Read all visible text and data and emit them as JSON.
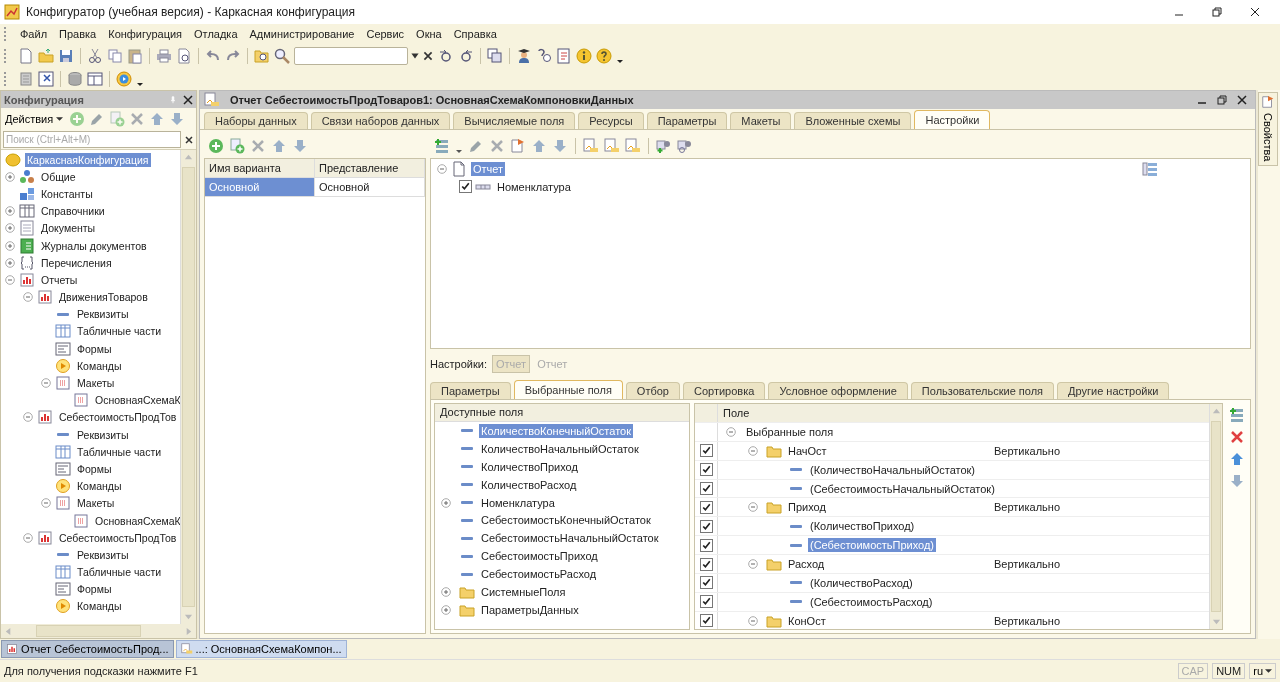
{
  "window": {
    "title": "Конфигуратор (учебная версия) - Каркасная конфигурация"
  },
  "menu": [
    "Файл",
    "Правка",
    "Конфигурация",
    "Отладка",
    "Администрирование",
    "Сервис",
    "Окна",
    "Справка"
  ],
  "left_panel": {
    "title": "Конфигурация",
    "actions_label": "Действия",
    "search": {
      "placeholder": "Поиск (Ctrl+Alt+M)"
    },
    "tree": {
      "label": "КаркаснаяКонфигурация",
      "kind": "root",
      "selected": true,
      "children": [
        {
          "label": "Общие",
          "kind": "common",
          "expanded": false,
          "selected": false
        },
        {
          "label": "Константы",
          "kind": "constants",
          "selected": false
        },
        {
          "label": "Справочники",
          "kind": "catalog",
          "expanded": false,
          "selected": false
        },
        {
          "label": "Документы",
          "kind": "document",
          "expanded": false,
          "selected": false
        },
        {
          "label": "Журналы документов",
          "kind": "journal",
          "expanded": false,
          "selected": false
        },
        {
          "label": "Перечисления",
          "kind": "enum",
          "expanded": false,
          "selected": false
        },
        {
          "label": "Отчеты",
          "kind": "report",
          "expanded": true,
          "selected": false,
          "children": [
            {
              "label": "ДвиженияТоваров",
              "kind": "report",
              "expanded": true,
              "selected": false,
              "children": [
                {
                  "label": "Реквизиты",
                  "kind": "attribute",
                  "selected": false
                },
                {
                  "label": "Табличные части",
                  "kind": "tabular",
                  "selected": false
                },
                {
                  "label": "Формы",
                  "kind": "form",
                  "selected": false
                },
                {
                  "label": "Команды",
                  "kind": "command",
                  "selected": false
                },
                {
                  "label": "Макеты",
                  "kind": "template",
                  "expanded": true,
                  "selected": false,
                  "children": [
                    {
                      "label": "ОсновнаяСхемаК",
                      "kind": "layout",
                      "selected": false
                    }
                  ]
                }
              ]
            },
            {
              "label": "СебестоимостьПродТов",
              "kind": "report",
              "expanded": true,
              "selected": false,
              "children": [
                {
                  "label": "Реквизиты",
                  "kind": "attribute",
                  "selected": false
                },
                {
                  "label": "Табличные части",
                  "kind": "tabular",
                  "selected": false
                },
                {
                  "label": "Формы",
                  "kind": "form",
                  "selected": false
                },
                {
                  "label": "Команды",
                  "kind": "command",
                  "selected": false
                },
                {
                  "label": "Макеты",
                  "kind": "template",
                  "expanded": true,
                  "selected": false,
                  "children": [
                    {
                      "label": "ОсновнаяСхемаК",
                      "kind": "layout",
                      "selected": false
                    }
                  ]
                }
              ]
            },
            {
              "label": "СебестоимостьПродТов",
              "kind": "report",
              "expanded": true,
              "selected": false,
              "children": [
                {
                  "label": "Реквизиты",
                  "kind": "attribute",
                  "selected": false
                },
                {
                  "label": "Табличные части",
                  "kind": "tabular",
                  "selected": false
                },
                {
                  "label": "Формы",
                  "kind": "form",
                  "selected": false
                },
                {
                  "label": "Команды",
                  "kind": "command",
                  "selected": false
                }
              ]
            }
          ]
        }
      ]
    }
  },
  "document": {
    "title": "Отчет СебестоимостьПродТоваров1: ОсновнаяСхемаКомпоновкиДанных",
    "tabs": [
      {
        "label": "Наборы данных",
        "selected": false
      },
      {
        "label": "Связи наборов данных",
        "selected": false
      },
      {
        "label": "Вычисляемые поля",
        "selected": false
      },
      {
        "label": "Ресурсы",
        "selected": false
      },
      {
        "label": "Параметры",
        "selected": false
      },
      {
        "label": "Макеты",
        "selected": false
      },
      {
        "label": "Вложенные схемы",
        "selected": false
      },
      {
        "label": "Настройки",
        "selected": true
      }
    ],
    "variants": {
      "columns": [
        "Имя варианта",
        "Представление"
      ],
      "rows": [
        {
          "cells": [
            "Основной",
            "Основной"
          ],
          "selected": true
        }
      ]
    },
    "structure": {
      "label": "Отчет",
      "expanded": true,
      "selected": true,
      "children": [
        {
          "label": "Номенклатура",
          "checked": true,
          "selected": false
        }
      ]
    },
    "settings_label": "Настройки:",
    "settings_buttons": [
      {
        "label": "Отчет",
        "pressed": true
      },
      {
        "label": "Отчет",
        "pressed": false
      }
    ],
    "subtabs": [
      {
        "label": "Параметры",
        "selected": false
      },
      {
        "label": "Выбранные поля",
        "selected": true
      },
      {
        "label": "Отбор",
        "selected": false
      },
      {
        "label": "Сортировка",
        "selected": false
      },
      {
        "label": "Условное оформление",
        "selected": false
      },
      {
        "label": "Пользовательские поля",
        "selected": false
      },
      {
        "label": "Другие настройки",
        "selected": false
      }
    ],
    "available_fields": {
      "title": "Доступные поля",
      "items": [
        {
          "label": "КоличествоКонечныйОстаток",
          "kind": "field",
          "selected": true
        },
        {
          "label": "КоличествоНачальныйОстаток",
          "kind": "field",
          "selected": false
        },
        {
          "label": "КоличествоПриход",
          "kind": "field",
          "selected": false
        },
        {
          "label": "КоличествоРасход",
          "kind": "field",
          "selected": false
        },
        {
          "label": "Номенклатура",
          "kind": "field",
          "expanded": false,
          "selected": false
        },
        {
          "label": "СебестоимостьКонечныйОстаток",
          "kind": "field",
          "selected": false
        },
        {
          "label": "СебестоимостьНачальныйОстаток",
          "kind": "field",
          "selected": false
        },
        {
          "label": "СебестоимостьПриход",
          "kind": "field",
          "selected": false
        },
        {
          "label": "СебестоимостьРасход",
          "kind": "field",
          "selected": false
        },
        {
          "label": "СистемныеПоля",
          "kind": "folder",
          "expanded": false,
          "selected": false
        },
        {
          "label": "ПараметрыДанных",
          "kind": "folder",
          "expanded": false,
          "selected": false
        }
      ]
    },
    "selected_fields": {
      "column": "Поле",
      "root": {
        "label": "Выбранные поля",
        "expanded": true,
        "children": [
          {
            "label": "НачОст",
            "kind": "folder",
            "checked": true,
            "expanded": true,
            "selected": false,
            "placement": "Вертикально",
            "children": [
              {
                "label": "(КоличествоНачальныйОстаток)",
                "kind": "field",
                "checked": true,
                "selected": false
              },
              {
                "label": "(СебестоимостьНачальныйОстаток)",
                "kind": "field",
                "checked": true,
                "selected": false
              }
            ]
          },
          {
            "label": "Приход",
            "kind": "folder",
            "checked": true,
            "expanded": true,
            "selected": false,
            "placement": "Вертикально",
            "children": [
              {
                "label": "(КоличествоПриход)",
                "kind": "field",
                "checked": true,
                "selected": false
              },
              {
                "label": "(СебестоимостьПриход)",
                "kind": "field",
                "checked": true,
                "selected": true
              }
            ]
          },
          {
            "label": "Расход",
            "kind": "folder",
            "checked": true,
            "expanded": true,
            "selected": false,
            "placement": "Вертикально",
            "children": [
              {
                "label": "(КоличествоРасход)",
                "kind": "field",
                "checked": true,
                "selected": false
              },
              {
                "label": "(СебестоимостьРасход)",
                "kind": "field",
                "checked": true,
                "selected": false
              }
            ]
          },
          {
            "label": "КонОст",
            "kind": "folder",
            "checked": true,
            "expanded": true,
            "selected": false,
            "placement": "Вертикально"
          }
        ]
      }
    }
  },
  "properties_strip": {
    "label": "Свойства"
  },
  "taskbar": [
    {
      "label": "Отчет СебестоимостьПрод...",
      "selected": true
    },
    {
      "label": "...: ОсновнаяСхемаКомпон...",
      "selected": false
    }
  ],
  "status_bar": {
    "hint": "Для получения подсказки нажмите F1",
    "indicators": [
      {
        "label": "CAP",
        "on": false
      },
      {
        "label": "NUM",
        "on": true
      }
    ],
    "language": "ru"
  }
}
